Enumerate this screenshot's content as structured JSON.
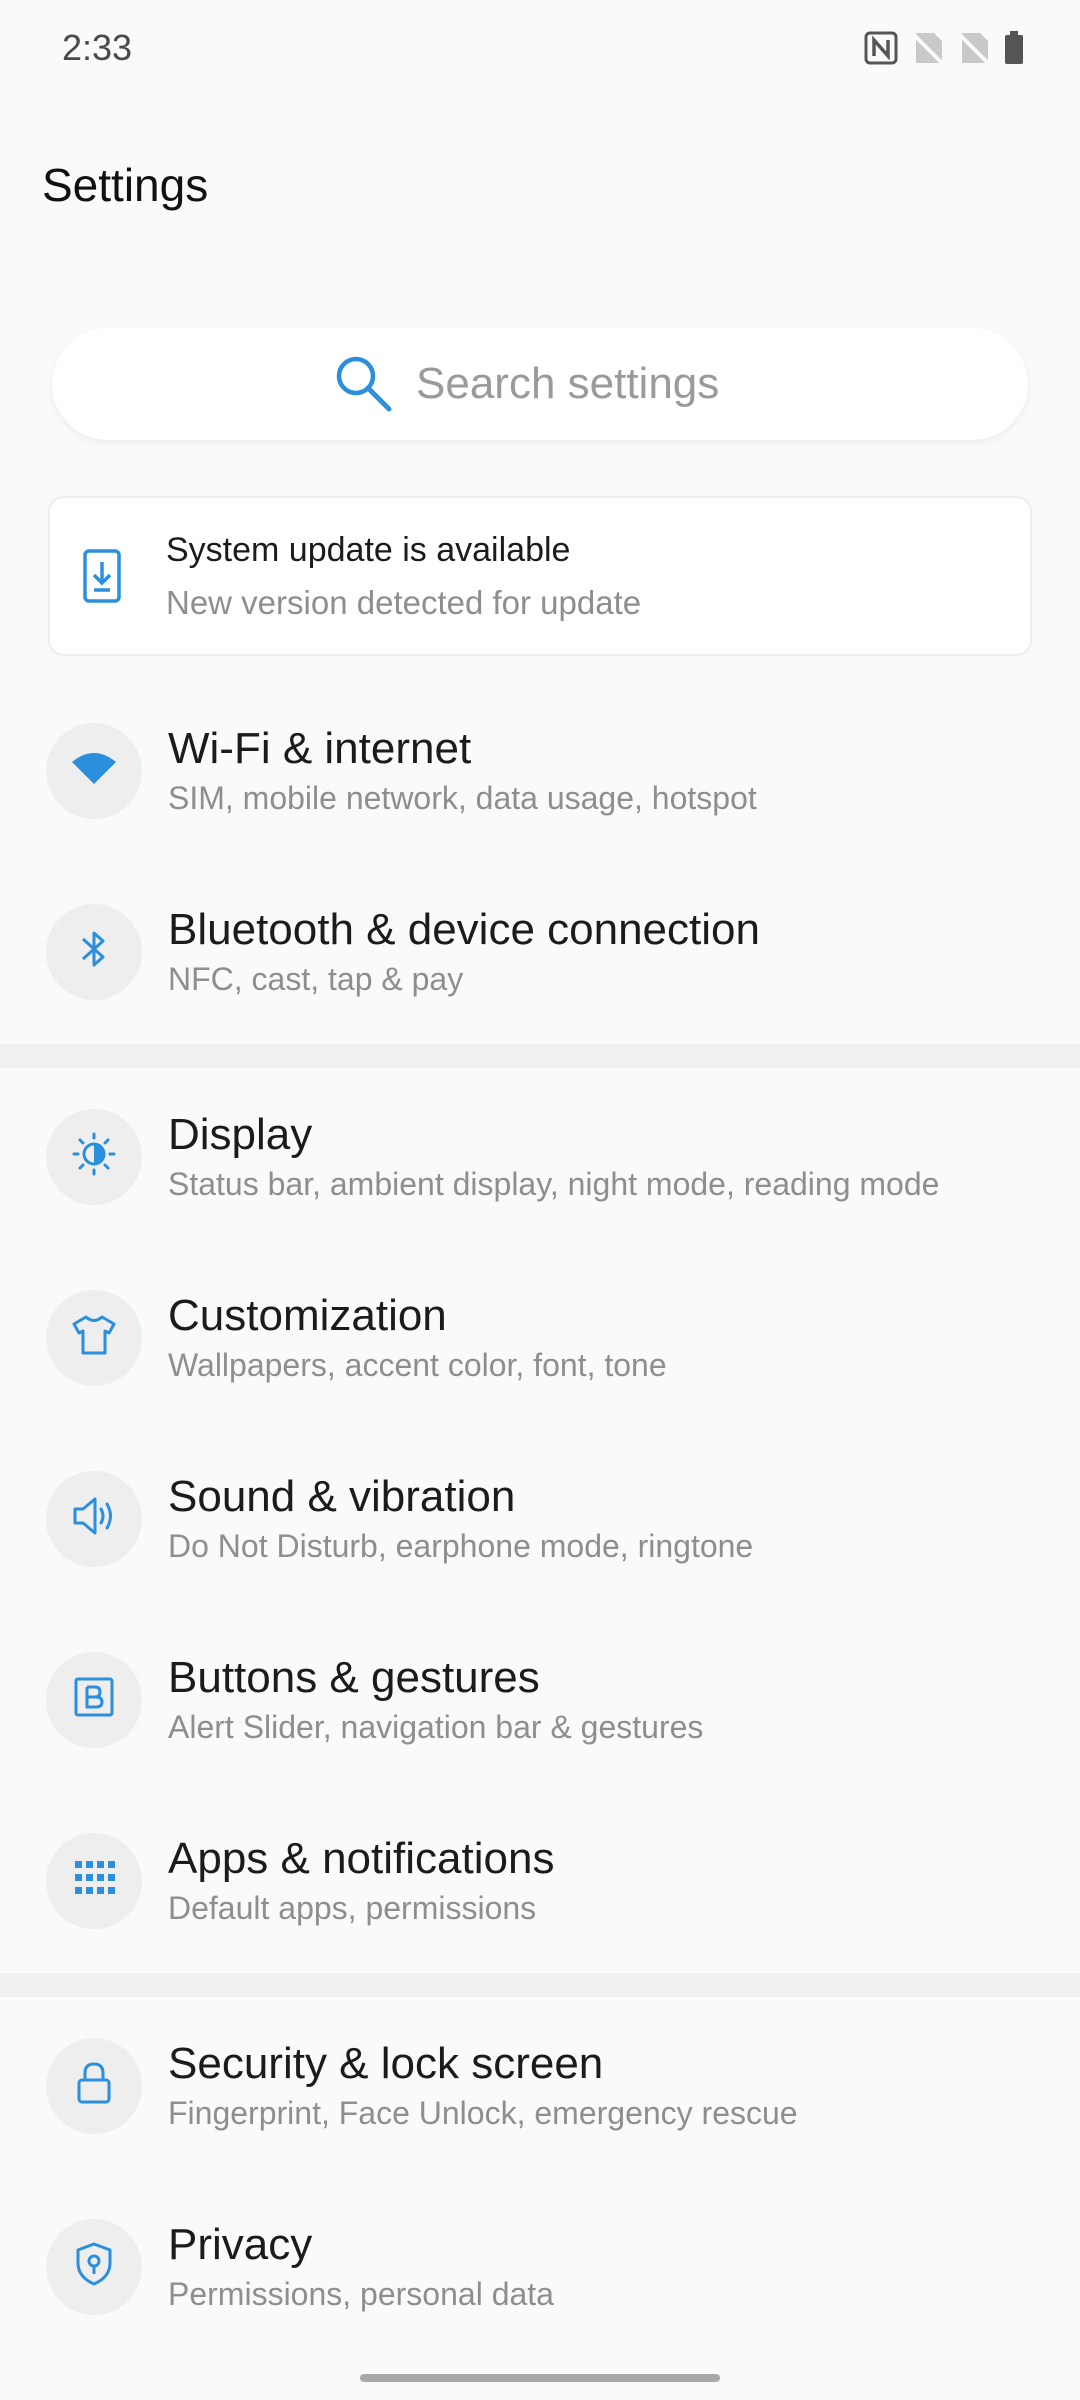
{
  "status_bar": {
    "time": "2:33",
    "icons": [
      "nfc-icon",
      "no-sim-icon",
      "no-sim-icon",
      "battery-icon"
    ]
  },
  "page_title": "Settings",
  "search": {
    "placeholder": "Search settings",
    "icon": "search-icon"
  },
  "update_card": {
    "title": "System update is available",
    "subtitle": "New version detected for update",
    "icon": "system-update-icon"
  },
  "items": [
    {
      "title": "Wi-Fi & internet",
      "subtitle": "SIM, mobile network, data usage, hotspot",
      "icon": "wifi-icon"
    },
    {
      "title": "Bluetooth & device connection",
      "subtitle": "NFC, cast, tap & pay",
      "icon": "bluetooth-icon"
    },
    {
      "title": "Display",
      "subtitle": "Status bar, ambient display, night mode, reading mode",
      "icon": "display-brightness-icon"
    },
    {
      "title": "Customization",
      "subtitle": "Wallpapers, accent color, font, tone",
      "icon": "tshirt-icon"
    },
    {
      "title": "Sound & vibration",
      "subtitle": "Do Not Disturb, earphone mode, ringtone",
      "icon": "speaker-icon"
    },
    {
      "title": "Buttons & gestures",
      "subtitle": "Alert Slider, navigation bar & gestures",
      "icon": "button-b-icon"
    },
    {
      "title": "Apps & notifications",
      "subtitle": "Default apps, permissions",
      "icon": "apps-grid-icon"
    },
    {
      "title": "Security & lock screen",
      "subtitle": "Fingerprint, Face Unlock, emergency rescue",
      "icon": "lock-icon"
    },
    {
      "title": "Privacy",
      "subtitle": "Permissions, personal data",
      "icon": "privacy-shield-icon"
    }
  ],
  "colors": {
    "accent": "#2b8fde",
    "background": "#fafafa",
    "divider": "#f0f0f0",
    "icon_circle": "#eeeeee",
    "primary_text": "#1b1b1b",
    "secondary_text": "#8e8e8e"
  }
}
